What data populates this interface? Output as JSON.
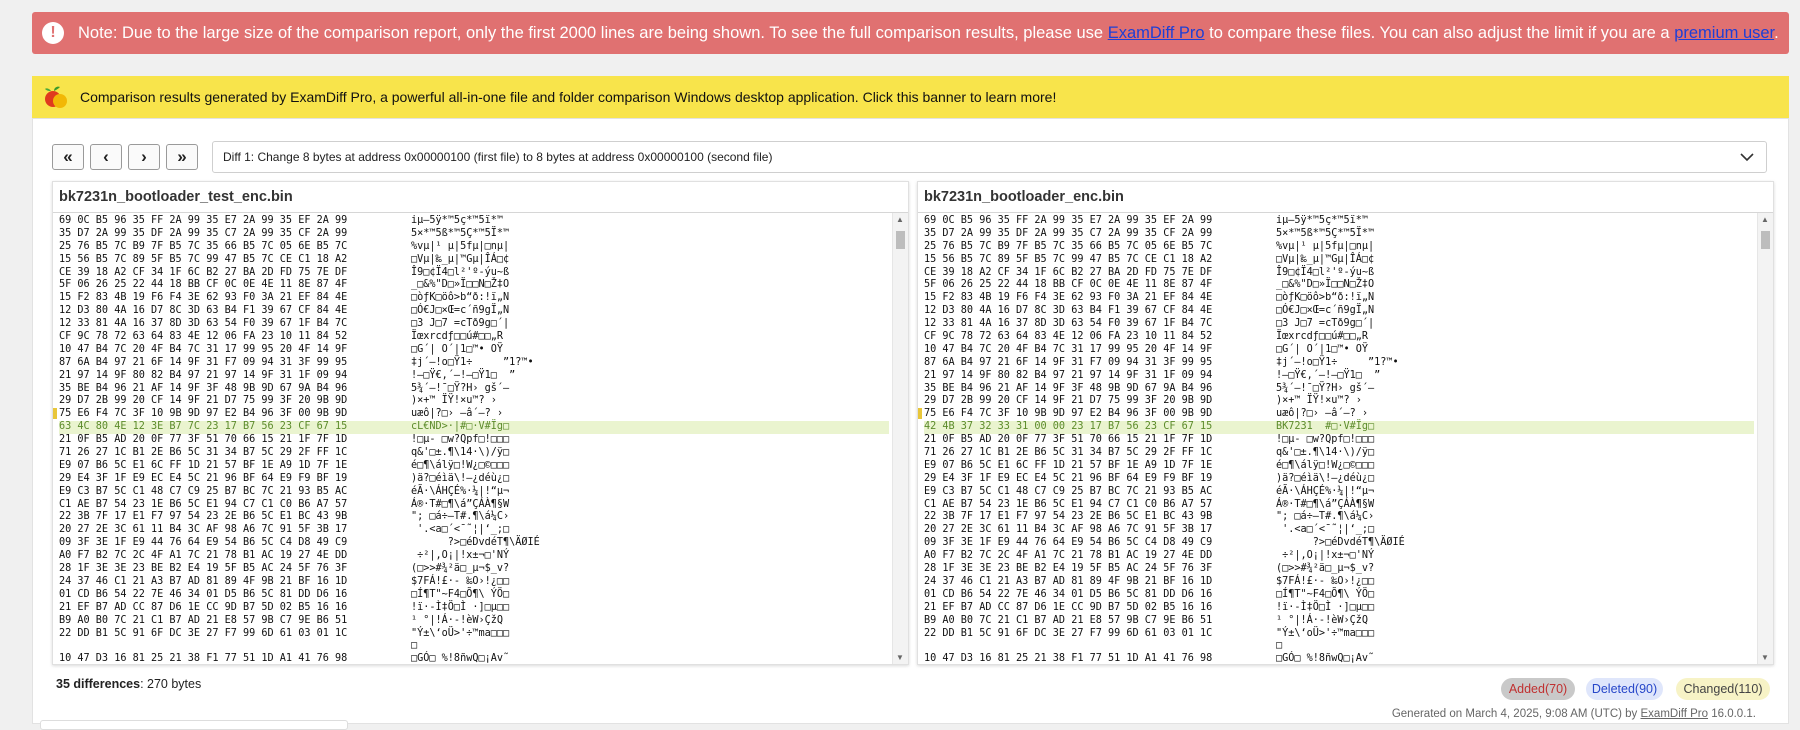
{
  "alert": {
    "text_before": "Note: Due to the large size of the comparison report, only the first 2000 lines are being shown. To see the full comparison results, please use ",
    "link1": "ExamDiff Pro",
    "text_middle": " to compare these files. You can also adjust the limit if you are a ",
    "link2": "premium user",
    "text_end": "."
  },
  "banner": {
    "text": "Comparison results generated by ExamDiff Pro, a powerful all-in-one file and folder comparison Windows desktop application. Click this banner to learn more!"
  },
  "nav": {
    "first": "«",
    "prev": "‹",
    "next": "›",
    "last": "»"
  },
  "diff_select": {
    "selected": "Diff 1: Change 8 bytes at address 0x00000100 (first file) to 8 bytes at address 0x00000100 (second file)"
  },
  "left": {
    "filename": "bk7231n_bootloader_test_enc.bin",
    "rows": [
      {
        "hex": "69 0C B5 96 35 FF 2A 99 35 E7 2A 99 35 EF 2A 99",
        "ascii": "iµ–5ÿ*™5ç*™5ï*™",
        "changed": false
      },
      {
        "hex": "35 D7 2A 99 35 DF 2A 99 35 C7 2A 99 35 CF 2A 99",
        "ascii": "5×*™5ß*™5Ç*™5Ï*™",
        "changed": false
      },
      {
        "hex": "25 76 B5 7C B9 7F B5 7C 35 66 B5 7C 05 6E B5 7C",
        "ascii": "%vµ|¹ µ|5fµ|□nµ|",
        "changed": false
      },
      {
        "hex": "15 56 B5 7C 89 5F B5 7C 99 47 B5 7C CE C1 18 A2",
        "ascii": "□Vµ|‰_µ|™Gµ|ÎÁ□¢",
        "changed": false
      },
      {
        "hex": "CE 39 18 A2 CF 34 1F 6C B2 27 BA 2D FD 75 7E DF",
        "ascii": "Î9□¢Ï4□l²'º-ýu~ß",
        "changed": false
      },
      {
        "hex": "5F 06 26 25 22 44 18 BB CF 0C 0E 4E 11 8E 87 4F",
        "ascii": "_□&%\"D□»Ï□□N□Ž‡O",
        "changed": false
      },
      {
        "hex": "15 F2 83 4B 19 F6 F4 3E 62 93 F0 3A 21 EF 84 4E",
        "ascii": "□òƒK□öô>b“ð:!ï„N",
        "changed": false
      },
      {
        "hex": "12 D3 80 4A 16 D7 8C 3D 63 B4 F1 39 67 CF 84 4E",
        "ascii": "□Ó€J□×Œ=c´ñ9gÏ„N",
        "changed": false
      },
      {
        "hex": "12 33 81 4A 16 37 8D 3D 63 54 F0 39 67 1F B4 7C",
        "ascii": "□3 J□7 =cTð9g□´|",
        "changed": false
      },
      {
        "hex": "CF 9C 78 72 63 64 83 4E 12 06 FA 23 10 11 84 52",
        "ascii": "Ïœxrcdƒ□□ú#□□„R",
        "changed": false
      },
      {
        "hex": "10 47 B4 7C 20 4F B4 7C 31 17 99 95 20 4F 14 9F",
        "ascii": "□G´| O´|1□™• OŸ",
        "changed": false
      },
      {
        "hex": "87 6A B4 97 21 6F 14 9F 31 F7 09 94 31 3F 99 95",
        "ascii": "‡j´—!o□Ÿ1÷     ”1?™•",
        "changed": false
      },
      {
        "hex": "21 97 14 9F 80 82 B4 97 21 97 14 9F 31 1F 09 94",
        "ascii": "!—□Ÿ€‚´—!—□Ÿ1□  ”",
        "changed": false
      },
      {
        "hex": "35 BE B4 96 21 AF 14 9F 3F 48 9B 9D 67 9A B4 96",
        "ascii": "5¾´–!¯□Ÿ?H› gš´–",
        "changed": false
      },
      {
        "hex": "29 D7 2B 99 20 CF 14 9F 21 D7 75 99 3F 20 9B 9D",
        "ascii": ")×+™ ÏŸ!×u™? ›",
        "changed": false
      },
      {
        "hex": "75 E6 F4 7C 3F 10 9B 9D 97 E2 B4 96 3F 00 9B 9D",
        "ascii": "uæô|?□› —â´–? ›",
        "changed": false
      },
      {
        "hex": "63 4C 80 4E 12 3E B7 7C 23 17 B7 56 23 CF 67 15",
        "ascii": "cL€ND>·|#□·V#Ïg□",
        "changed": true
      },
      {
        "hex": "21 0F B5 AD 20 0F 77 3F 51 70 66 15 21 1F 7F 1D",
        "ascii": "!□µ- □w?Qpf□!□□□",
        "changed": false
      },
      {
        "hex": "71 26 27 1C B1 2E B6 5C 31 34 B7 5C 29 2F FF 1C",
        "ascii": "q&'□±.¶\\14·\\)/ÿ□",
        "changed": false
      },
      {
        "hex": "E9 07 B6 5C E1 6C FF 1D 21 57 BF 1E A9 1D 7F 1E",
        "ascii": "é□¶\\álÿ□!W¿□©□□□",
        "changed": false
      },
      {
        "hex": "29 E4 3F 1F E9 EC E4 5C 21 96 BF 64 E9 F9 BF 19",
        "ascii": ")ä?□éìä\\!–¿déù¿□",
        "changed": false
      },
      {
        "hex": "E9 C3 B7 5C C1 48 C7 C9 25 B7 BC 7C 21 93 B5 AC",
        "ascii": "éÃ·\\ÁHÇÉ%·¼|!“µ¬",
        "changed": false
      },
      {
        "hex": "C1 AE B7 54 23 1E B6 5C E1 94 C7 C1 C0 B6 A7 57",
        "ascii": "Á®·T#□¶\\á”ÇÁÀ¶§W",
        "changed": false
      },
      {
        "hex": "22 3B 7F 17 E1 F7 97 54 23 2E B6 5C E1 BC 43 9B",
        "ascii": "\"; □á÷—T#.¶\\á¼C›",
        "changed": false
      },
      {
        "hex": "20 27 2E 3C 61 11 B4 3C AF 98 A6 7C 91 5F 3B 17",
        "ascii": " '.<a□´<¯˜¦|‘_;□",
        "changed": false
      },
      {
        "hex": "09 3F 3E 1F E9 44 76 64 E9 54 B6 5C C4 D8 49 C9",
        "ascii": "      ?>□éDvdéT¶\\ÄØIÉ",
        "changed": false
      },
      {
        "hex": "A0 F7 B2 7C 2C 4F A1 7C 21 78 B1 AC 19 27 4E DD",
        "ascii": " ÷²|,O¡|!x±¬□'NÝ",
        "changed": false
      },
      {
        "hex": "28 1F 3E 3E 23 BE B2 E4 19 5F B5 AC 24 5F 76 3F",
        "ascii": "(□>>#¾²ä□_µ¬$_v?",
        "changed": false
      },
      {
        "hex": "24 37 46 C1 21 A3 B7 AD 81 89 4F 9B 21 BF 16 1D",
        "ascii": "$7FÁ!£·- ‰O›!¿□□",
        "changed": false
      },
      {
        "hex": "01 CD B6 54 22 7E 46 34 01 D5 B6 5C 81 DD D6 16",
        "ascii": "□Í¶T\"~F4□Õ¶\\ ÝÖ□",
        "changed": false
      },
      {
        "hex": "21 EF B7 AD CC 87 D6 1E CC 9D B7 5D 02 B5 16 16",
        "ascii": "!ï·-Ì‡Ö□Ì ·]□µ□□",
        "changed": false
      },
      {
        "hex": "B9 A0 B0 7C 21 C1 B7 AD 21 E8 57 9B C7 9E B6 51",
        "ascii": "¹ °|!Á·-!èW›ÇžQ",
        "changed": false
      },
      {
        "hex": "22 DD B1 5C 91 6F DC 3E 27 F7 99 6D 61 03 01 1C",
        "ascii": "\"Ý±\\‘oÜ>'÷™ma□□□",
        "changed": false
      },
      {
        "hex": "",
        "ascii": "□",
        "changed": false
      },
      {
        "hex": "10 47 D3 16 81 25 21 38 F1 77 51 1D A1 41 76 98",
        "ascii": "□GÓ□ %!8ñwQ□¡Av˜",
        "changed": false
      }
    ]
  },
  "right": {
    "filename": "bk7231n_bootloader_enc.bin",
    "rows": [
      {
        "hex": "69 0C B5 96 35 FF 2A 99 35 E7 2A 99 35 EF 2A 99",
        "ascii": "iµ–5ÿ*™5ç*™5ï*™",
        "changed": false
      },
      {
        "hex": "35 D7 2A 99 35 DF 2A 99 35 C7 2A 99 35 CF 2A 99",
        "ascii": "5×*™5ß*™5Ç*™5Ï*™",
        "changed": false
      },
      {
        "hex": "25 76 B5 7C B9 7F B5 7C 35 66 B5 7C 05 6E B5 7C",
        "ascii": "%vµ|¹ µ|5fµ|□nµ|",
        "changed": false
      },
      {
        "hex": "15 56 B5 7C 89 5F B5 7C 99 47 B5 7C CE C1 18 A2",
        "ascii": "□Vµ|‰_µ|™Gµ|ÎÁ□¢",
        "changed": false
      },
      {
        "hex": "CE 39 18 A2 CF 34 1F 6C B2 27 BA 2D FD 75 7E DF",
        "ascii": "Î9□¢Ï4□l²'º-ýu~ß",
        "changed": false
      },
      {
        "hex": "5F 06 26 25 22 44 18 BB CF 0C 0E 4E 11 8E 87 4F",
        "ascii": "_□&%\"D□»Ï□□N□Ž‡O",
        "changed": false
      },
      {
        "hex": "15 F2 83 4B 19 F6 F4 3E 62 93 F0 3A 21 EF 84 4E",
        "ascii": "□òƒK□öô>b“ð:!ï„N",
        "changed": false
      },
      {
        "hex": "12 D3 80 4A 16 D7 8C 3D 63 B4 F1 39 67 CF 84 4E",
        "ascii": "□Ó€J□×Œ=c´ñ9gÏ„N",
        "changed": false
      },
      {
        "hex": "12 33 81 4A 16 37 8D 3D 63 54 F0 39 67 1F B4 7C",
        "ascii": "□3 J□7 =cTð9g□´|",
        "changed": false
      },
      {
        "hex": "CF 9C 78 72 63 64 83 4E 12 06 FA 23 10 11 84 52",
        "ascii": "Ïœxrcdƒ□□ú#□□„R",
        "changed": false
      },
      {
        "hex": "10 47 B4 7C 20 4F B4 7C 31 17 99 95 20 4F 14 9F",
        "ascii": "□G´| O´|1□™• OŸ",
        "changed": false
      },
      {
        "hex": "87 6A B4 97 21 6F 14 9F 31 F7 09 94 31 3F 99 95",
        "ascii": "‡j´—!o□Ÿ1÷     ”1?™•",
        "changed": false
      },
      {
        "hex": "21 97 14 9F 80 82 B4 97 21 97 14 9F 31 1F 09 94",
        "ascii": "!—□Ÿ€‚´—!—□Ÿ1□  ”",
        "changed": false
      },
      {
        "hex": "35 BE B4 96 21 AF 14 9F 3F 48 9B 9D 67 9A B4 96",
        "ascii": "5¾´–!¯□Ÿ?H› gš´–",
        "changed": false
      },
      {
        "hex": "29 D7 2B 99 20 CF 14 9F 21 D7 75 99 3F 20 9B 9D",
        "ascii": ")×+™ ÏŸ!×u™? ›",
        "changed": false
      },
      {
        "hex": "75 E6 F4 7C 3F 10 9B 9D 97 E2 B4 96 3F 00 9B 9D",
        "ascii": "uæô|?□› —â´–? ›",
        "changed": false
      },
      {
        "hex": "42 4B 37 32 33 31 00 00 23 17 B7 56 23 CF 67 15",
        "ascii": "BK7231  #□·V#Ïg□",
        "changed": true
      },
      {
        "hex": "21 0F B5 AD 20 0F 77 3F 51 70 66 15 21 1F 7F 1D",
        "ascii": "!□µ- □w?Qpf□!□□□",
        "changed": false
      },
      {
        "hex": "71 26 27 1C B1 2E B6 5C 31 34 B7 5C 29 2F FF 1C",
        "ascii": "q&'□±.¶\\14·\\)/ÿ□",
        "changed": false
      },
      {
        "hex": "E9 07 B6 5C E1 6C FF 1D 21 57 BF 1E A9 1D 7F 1E",
        "ascii": "é□¶\\álÿ□!W¿□©□□□",
        "changed": false
      },
      {
        "hex": "29 E4 3F 1F E9 EC E4 5C 21 96 BF 64 E9 F9 BF 19",
        "ascii": ")ä?□éìä\\!–¿déù¿□",
        "changed": false
      },
      {
        "hex": "E9 C3 B7 5C C1 48 C7 C9 25 B7 BC 7C 21 93 B5 AC",
        "ascii": "éÃ·\\ÁHÇÉ%·¼|!“µ¬",
        "changed": false
      },
      {
        "hex": "C1 AE B7 54 23 1E B6 5C E1 94 C7 C1 C0 B6 A7 57",
        "ascii": "Á®·T#□¶\\á”ÇÁÀ¶§W",
        "changed": false
      },
      {
        "hex": "22 3B 7F 17 E1 F7 97 54 23 2E B6 5C E1 BC 43 9B",
        "ascii": "\"; □á÷—T#.¶\\á¼C›",
        "changed": false
      },
      {
        "hex": "20 27 2E 3C 61 11 B4 3C AF 98 A6 7C 91 5F 3B 17",
        "ascii": " '.<a□´<¯˜¦|‘_;□",
        "changed": false
      },
      {
        "hex": "09 3F 3E 1F E9 44 76 64 E9 54 B6 5C C4 D8 49 C9",
        "ascii": "      ?>□éDvdéT¶\\ÄØIÉ",
        "changed": false
      },
      {
        "hex": "A0 F7 B2 7C 2C 4F A1 7C 21 78 B1 AC 19 27 4E DD",
        "ascii": " ÷²|,O¡|!x±¬□'NÝ",
        "changed": false
      },
      {
        "hex": "28 1F 3E 3E 23 BE B2 E4 19 5F B5 AC 24 5F 76 3F",
        "ascii": "(□>>#¾²ä□_µ¬$_v?",
        "changed": false
      },
      {
        "hex": "24 37 46 C1 21 A3 B7 AD 81 89 4F 9B 21 BF 16 1D",
        "ascii": "$7FÁ!£·- ‰O›!¿□□",
        "changed": false
      },
      {
        "hex": "01 CD B6 54 22 7E 46 34 01 D5 B6 5C 81 DD D6 16",
        "ascii": "□Í¶T\"~F4□Õ¶\\ ÝÖ□",
        "changed": false
      },
      {
        "hex": "21 EF B7 AD CC 87 D6 1E CC 9D B7 5D 02 B5 16 16",
        "ascii": "!ï·-Ì‡Ö□Ì ·]□µ□□",
        "changed": false
      },
      {
        "hex": "B9 A0 B0 7C 21 C1 B7 AD 21 E8 57 9B C7 9E B6 51",
        "ascii": "¹ °|!Á·-!èW›ÇžQ",
        "changed": false
      },
      {
        "hex": "22 DD B1 5C 91 6F DC 3E 27 F7 99 6D 61 03 01 1C",
        "ascii": "\"Ý±\\‘oÜ>'÷™ma□□□",
        "changed": false
      },
      {
        "hex": "",
        "ascii": "□",
        "changed": false
      },
      {
        "hex": "10 47 D3 16 81 25 21 38 F1 77 51 1D A1 41 76 98",
        "ascii": "□GÓ□ %!8ñwQ□¡Av˜",
        "changed": false
      }
    ]
  },
  "summary": {
    "count": "35 differences",
    "bytes": ": 270 bytes"
  },
  "pills": {
    "added": "Added(70)",
    "deleted": "Deleted(90)",
    "changed": "Changed(110)"
  },
  "colors": {
    "alert_bg": "#e07171",
    "banner_bg": "#f8e44b",
    "changed_row_bg": "#eaf4cf",
    "added_pill": "#c9c9c9",
    "deleted_pill": "#dfe6fb",
    "changed_pill": "#f7f3c6"
  },
  "footer": {
    "text": "Generated on March 4, 2025, 9:08 AM (UTC) by ",
    "link": "ExamDiff Pro",
    "version": " 16.0.0.1."
  }
}
